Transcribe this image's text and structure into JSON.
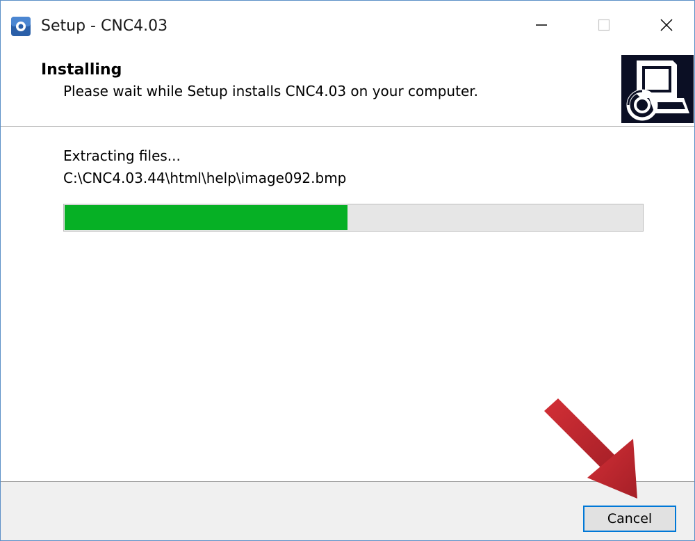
{
  "window": {
    "title": "Setup - CNC4.03",
    "controls": {
      "minimize_icon": "minimize-icon",
      "maximize_icon": "maximize-icon",
      "close_icon": "close-icon"
    }
  },
  "header": {
    "title": "Installing",
    "subtitle": "Please wait while Setup installs CNC4.03 on your computer.",
    "image_icon": "computer-install-icon"
  },
  "main": {
    "status": "Extracting files...",
    "current_file": "C:\\CNC4.03.44\\html\\help\\image092.bmp",
    "progress_percent": 49
  },
  "footer": {
    "cancel_label": "Cancel"
  },
  "colors": {
    "progress_fill": "#06b025",
    "progress_track": "#e6e6e6",
    "footer_bg": "#f0f0f0",
    "focus_border": "#0078d7",
    "annotation_arrow": "#c1272d",
    "header_image_bg": "#0b0f24"
  },
  "annotation": {
    "icon": "red-arrow-icon",
    "points_to": "cancel-button"
  }
}
